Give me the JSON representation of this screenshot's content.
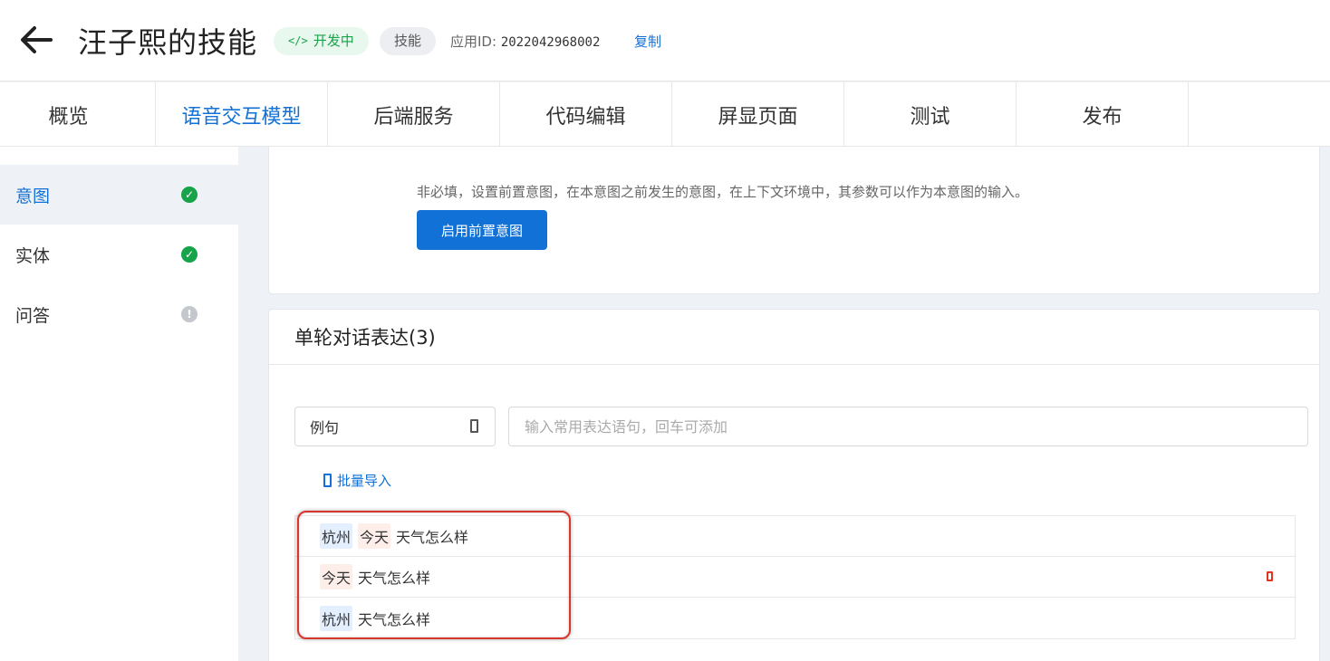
{
  "header": {
    "title": "汪子熙的技能",
    "status_badge": "开发中",
    "status_icon": "code-icon",
    "type_badge": "技能",
    "app_id_label": "应用ID:",
    "app_id_value": "2022042968002",
    "copy_label": "复制"
  },
  "tabs": [
    {
      "label": "概览"
    },
    {
      "label": "语音交互模型",
      "active": true
    },
    {
      "label": "后端服务"
    },
    {
      "label": "代码编辑"
    },
    {
      "label": "屏显页面"
    },
    {
      "label": "测试"
    },
    {
      "label": "发布"
    }
  ],
  "sidebar": {
    "items": [
      {
        "label": "意图",
        "status": "complete",
        "active": true
      },
      {
        "label": "实体",
        "status": "complete"
      },
      {
        "label": "问答",
        "status": "warning"
      }
    ]
  },
  "pre_intent": {
    "hint": "非必填，设置前置意图，在本意图之前发生的意图，在上下文环境中，其参数可以作为本意图的输入。",
    "button_label": "启用前置意图"
  },
  "expressions": {
    "title": "单轮对话表达(3)",
    "type_select": "例句",
    "input_placeholder": "输入常用表达语句，回车可添加",
    "import_label": "批量导入",
    "rows": [
      {
        "tokens": [
          {
            "text": "杭州",
            "type": "loc"
          },
          {
            "text": "今天",
            "type": "time"
          },
          {
            "text": "天气怎么样",
            "type": "plain"
          }
        ]
      },
      {
        "tokens": [
          {
            "text": "今天",
            "type": "time"
          },
          {
            "text": "天气怎么样",
            "type": "plain"
          }
        ]
      },
      {
        "tokens": [
          {
            "text": "杭州",
            "type": "loc"
          },
          {
            "text": "天气怎么样",
            "type": "plain"
          }
        ]
      }
    ]
  },
  "colors": {
    "primary": "#1271d6",
    "success": "#16a34a",
    "danger": "#e0341c",
    "entity_location_bg": "#e3efff",
    "entity_time_bg": "#fdeee9"
  }
}
